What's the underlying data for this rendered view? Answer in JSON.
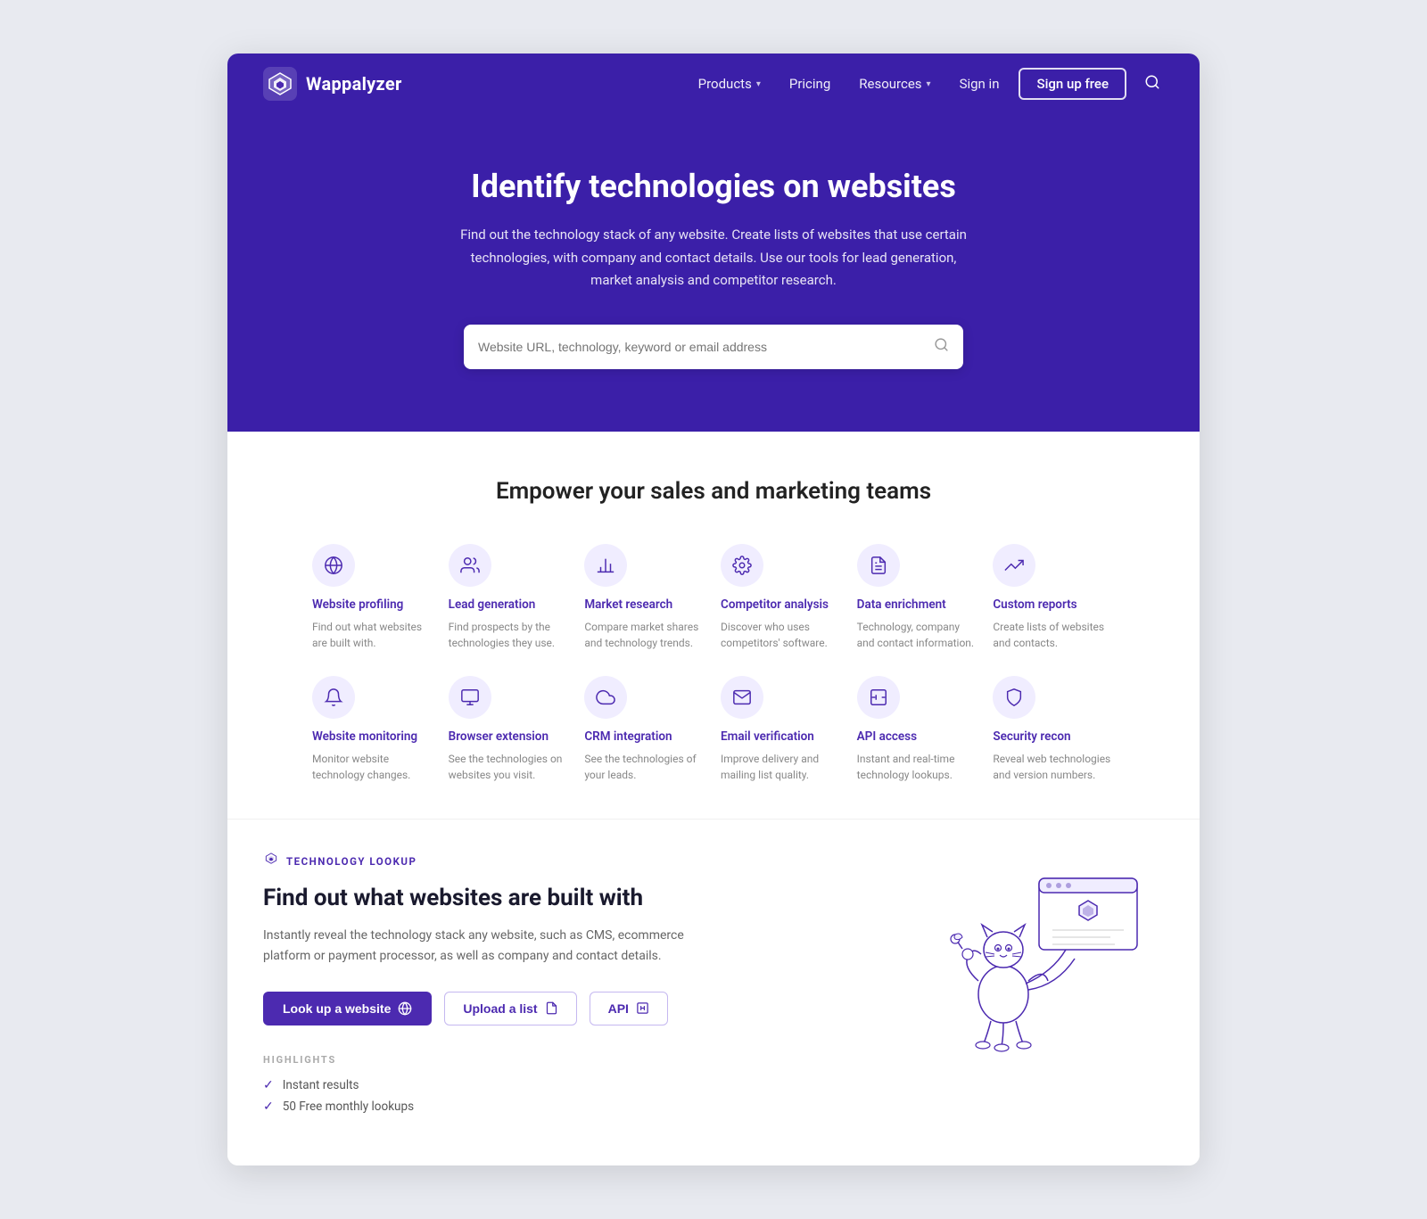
{
  "nav": {
    "logo_text": "Wappalyzer",
    "links": [
      {
        "label": "Products",
        "has_dropdown": true
      },
      {
        "label": "Pricing",
        "has_dropdown": false
      },
      {
        "label": "Resources",
        "has_dropdown": true
      }
    ],
    "signin_label": "Sign in",
    "signup_label": "Sign up free"
  },
  "hero": {
    "title": "Identify technologies on websites",
    "subtitle": "Find out the technology stack of any website. Create lists of websites that use certain technologies, with company and contact details. Use our tools for lead generation, market analysis and competitor research.",
    "search_placeholder": "Website URL, technology, keyword or email address"
  },
  "features": {
    "section_title": "Empower your sales and marketing teams",
    "items": [
      {
        "name": "Website profiling",
        "desc": "Find out what websites are built with.",
        "icon": "globe"
      },
      {
        "name": "Lead generation",
        "desc": "Find prospects by the technologies they use.",
        "icon": "users"
      },
      {
        "name": "Market research",
        "desc": "Compare market shares and technology trends.",
        "icon": "bar-chart"
      },
      {
        "name": "Competitor analysis",
        "desc": "Discover who uses competitors' software.",
        "icon": "settings"
      },
      {
        "name": "Data enrichment",
        "desc": "Technology, company and contact information.",
        "icon": "file"
      },
      {
        "name": "Custom reports",
        "desc": "Create lists of websites and contacts.",
        "icon": "trending-up"
      },
      {
        "name": "Website monitoring",
        "desc": "Monitor website technology changes.",
        "icon": "bell"
      },
      {
        "name": "Browser extension",
        "desc": "See the technologies on websites you visit.",
        "icon": "monitor"
      },
      {
        "name": "CRM integration",
        "desc": "See the technologies of your leads.",
        "icon": "cloud"
      },
      {
        "name": "Email verification",
        "desc": "Improve delivery and mailing list quality.",
        "icon": "mail"
      },
      {
        "name": "API access",
        "desc": "Instant and real-time technology lookups.",
        "icon": "code"
      },
      {
        "name": "Security recon",
        "desc": "Reveal web technologies and version numbers.",
        "icon": "shield"
      }
    ]
  },
  "lookup": {
    "badge": "TECHNOLOGY LOOKUP",
    "title": "Find out what websites are built with",
    "desc": "Instantly reveal the technology stack any website, such as CMS, ecommerce platform or payment processor, as well as company and contact details.",
    "btn_primary": "Look up a website",
    "btn_upload": "Upload a list",
    "btn_api": "API",
    "highlights_label": "HIGHLIGHTS",
    "highlights": [
      "Instant results",
      "50 Free monthly lookups"
    ]
  },
  "colors": {
    "brand_purple": "#4c2ab0",
    "hero_bg": "#3b1fa8",
    "light_purple": "#f0edff"
  }
}
